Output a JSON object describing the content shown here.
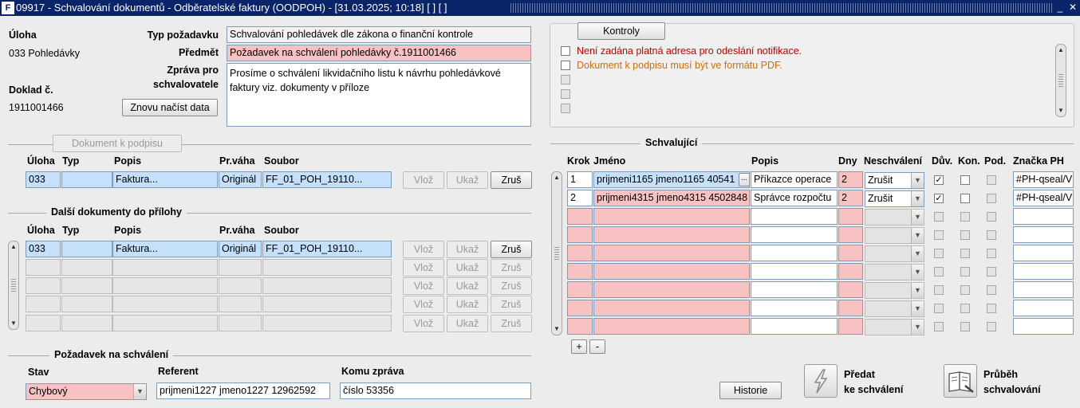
{
  "window": {
    "logo": "F",
    "title": "09917 - Schvalování dokumentů - Odběratelské faktury (OODPOH) - [31.03.2025; 10:18]  [ ]  [ ]",
    "minimize": "_",
    "close": "✕"
  },
  "header": {
    "uloha_label": "Úloha",
    "uloha_value": "033 Pohledávky",
    "doklad_label": "Doklad č.",
    "doklad_value": "1911001466",
    "reload_button": "Znovu načíst data",
    "typ_label": "Typ požadavku",
    "typ_value": "Schvalování pohledávek dle zákona o finanční kontrole",
    "predmet_label": "Předmět",
    "predmet_value": "Požadavek na schválení pohledávky č.1911001466",
    "zprava_label_1": "Zpráva pro",
    "zprava_label_2": "schvalovatele",
    "zprava_value": "Prosíme o schválení likvidačního listu k návrhu pohledávkové faktury viz. dokumenty v příloze"
  },
  "kontroly": {
    "button": "Kontroly",
    "messages": [
      {
        "text": "Není zadána platná adresa pro odeslání notifikace.",
        "color": "#cc0000"
      },
      {
        "text": "Dokument k podpisu musí být ve formátu PDF.",
        "color": "#d07000"
      },
      {
        "text": ""
      },
      {
        "text": ""
      },
      {
        "text": ""
      }
    ]
  },
  "doc_sign": {
    "button": "Dokument k podpisu",
    "headers": {
      "uloha": "Úloha",
      "typ": "Typ",
      "popis": "Popis",
      "prvaha": "Pr.váha",
      "soubor": "Soubor"
    },
    "row": {
      "uloha": "033",
      "typ": "",
      "popis": "Faktura...",
      "prvaha": "Originál",
      "soubor": "FF_01_POH_19110..."
    },
    "btn_vloz": "Vlož",
    "btn_ukaz": "Ukaž",
    "btn_zrus": "Zruš"
  },
  "attachments": {
    "title": "Další dokumenty do přílohy",
    "headers": {
      "uloha": "Úloha",
      "typ": "Typ",
      "popis": "Popis",
      "prvaha": "Pr.váha",
      "soubor": "Soubor"
    },
    "rows": [
      {
        "uloha": "033",
        "typ": "",
        "popis": "Faktura...",
        "prvaha": "Originál",
        "soubor": "FF_01_POH_19110..."
      },
      {
        "uloha": "",
        "typ": "",
        "popis": "",
        "prvaha": "",
        "soubor": ""
      },
      {
        "uloha": "",
        "typ": "",
        "popis": "",
        "prvaha": "",
        "soubor": ""
      },
      {
        "uloha": "",
        "typ": "",
        "popis": "",
        "prvaha": "",
        "soubor": ""
      },
      {
        "uloha": "",
        "typ": "",
        "popis": "",
        "prvaha": "",
        "soubor": ""
      }
    ],
    "btn_vloz": "Vlož",
    "btn_ukaz": "Ukaž",
    "btn_zrus": "Zruš"
  },
  "approvers": {
    "title": "Schvalující",
    "headers": {
      "krok": "Krok",
      "jmeno": "Jméno",
      "popis": "Popis",
      "dny": "Dny",
      "neschvaleni": "Neschválení",
      "duv": "Dův.",
      "kon": "Kon.",
      "pod": "Pod.",
      "znacka": "Značka PH"
    },
    "rows": [
      {
        "krok": "1",
        "jmeno": "prijmeni1165 jmeno1165 40541",
        "popis": "Příkazce operace",
        "dny": "2",
        "neschvaleni": "Zrušit",
        "duv": true,
        "kon": false,
        "pod": false,
        "znacka": "#PH-qseal/V"
      },
      {
        "krok": "2",
        "jmeno": "prijmeni4315 jmeno4315 4502848",
        "popis": "Správce rozpočtu",
        "dny": "2",
        "neschvaleni": "Zrušit",
        "duv": true,
        "kon": false,
        "pod": false,
        "znacka": "#PH-qseal/V"
      },
      {
        "krok": "",
        "jmeno": "",
        "popis": "",
        "dny": "",
        "neschvaleni": "",
        "duv": false,
        "kon": false,
        "pod": false,
        "znacka": ""
      },
      {
        "krok": "",
        "jmeno": "",
        "popis": "",
        "dny": "",
        "neschvaleni": "",
        "duv": false,
        "kon": false,
        "pod": false,
        "znacka": ""
      },
      {
        "krok": "",
        "jmeno": "",
        "popis": "",
        "dny": "",
        "neschvaleni": "",
        "duv": false,
        "kon": false,
        "pod": false,
        "znacka": ""
      },
      {
        "krok": "",
        "jmeno": "",
        "popis": "",
        "dny": "",
        "neschvaleni": "",
        "duv": false,
        "kon": false,
        "pod": false,
        "znacka": ""
      },
      {
        "krok": "",
        "jmeno": "",
        "popis": "",
        "dny": "",
        "neschvaleni": "",
        "duv": false,
        "kon": false,
        "pod": false,
        "znacka": ""
      },
      {
        "krok": "",
        "jmeno": "",
        "popis": "",
        "dny": "",
        "neschvaleni": "",
        "duv": false,
        "kon": false,
        "pod": false,
        "znacka": ""
      },
      {
        "krok": "",
        "jmeno": "",
        "popis": "",
        "dny": "",
        "neschvaleni": "",
        "duv": false,
        "kon": false,
        "pod": false,
        "znacka": ""
      }
    ],
    "lov_button": "...",
    "add_button": "+",
    "remove_button": "-"
  },
  "request": {
    "title": "Požadavek na schválení",
    "stav_label": "Stav",
    "stav_value": "Chybový",
    "referent_label": "Referent",
    "referent_value": "prijmeni1227 jmeno1227 12962592",
    "komu_label": "Komu zpráva",
    "komu_value": "číslo 53356"
  },
  "actions": {
    "historie": "Historie",
    "predat_1": "Předat",
    "predat_2": "ke schválení",
    "prubeh_1": "Průběh",
    "prubeh_2": "schvalování"
  }
}
